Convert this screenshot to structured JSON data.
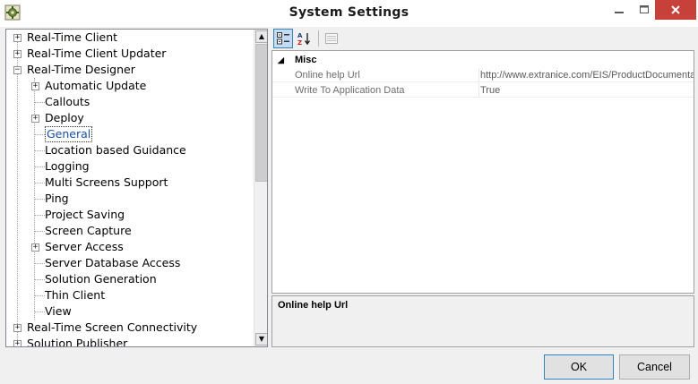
{
  "window": {
    "title": "System Settings",
    "minimize_glyph": "▬",
    "maximize_glyph": "□",
    "close_glyph": "✕",
    "app_icon": "gear-icon"
  },
  "tree": {
    "items": [
      {
        "label": "Real-Time Client",
        "level": 0,
        "expander": "+"
      },
      {
        "label": "Real-Time Client Updater",
        "level": 0,
        "expander": "+"
      },
      {
        "label": "Real-Time Designer",
        "level": 0,
        "expander": "−"
      },
      {
        "label": "Automatic Update",
        "level": 1,
        "expander": "+"
      },
      {
        "label": "Callouts",
        "level": 1,
        "expander": ""
      },
      {
        "label": "Deploy",
        "level": 1,
        "expander": "+"
      },
      {
        "label": "General",
        "level": 1,
        "expander": "",
        "selected": true
      },
      {
        "label": "Location based Guidance",
        "level": 1,
        "expander": ""
      },
      {
        "label": "Logging",
        "level": 1,
        "expander": ""
      },
      {
        "label": "Multi Screens Support",
        "level": 1,
        "expander": ""
      },
      {
        "label": "Ping",
        "level": 1,
        "expander": ""
      },
      {
        "label": "Project Saving",
        "level": 1,
        "expander": ""
      },
      {
        "label": "Screen Capture",
        "level": 1,
        "expander": ""
      },
      {
        "label": "Server Access",
        "level": 1,
        "expander": "+"
      },
      {
        "label": "Server Database Access",
        "level": 1,
        "expander": ""
      },
      {
        "label": "Solution Generation",
        "level": 1,
        "expander": ""
      },
      {
        "label": "Thin Client",
        "level": 1,
        "expander": ""
      },
      {
        "label": "View",
        "level": 1,
        "expander": ""
      },
      {
        "label": "Real-Time Screen Connectivity",
        "level": 0,
        "expander": "+"
      },
      {
        "label": "Solution Publisher",
        "level": 0,
        "expander": "+"
      }
    ],
    "scroll_up_glyph": "▲",
    "scroll_down_glyph": "▼"
  },
  "property_grid": {
    "toolbar": {
      "categorized_glyph": "☷",
      "alphabetical_glyph": "A↓",
      "pages_glyph": "▤"
    },
    "category": {
      "toggle": "◢",
      "label": "Misc"
    },
    "properties": [
      {
        "name": "Online help Url",
        "value": "http://www.extranice.com/EIS/ProductDocumentation"
      },
      {
        "name": "Write To Application Data",
        "value": "True"
      }
    ],
    "description_title": "Online help Url"
  },
  "buttons": {
    "ok_label": "OK",
    "cancel_label": "Cancel"
  },
  "colors": {
    "close_button": "#c7413a",
    "selected_text": "#1650a8",
    "default_button_border": "#3c7fb1"
  }
}
